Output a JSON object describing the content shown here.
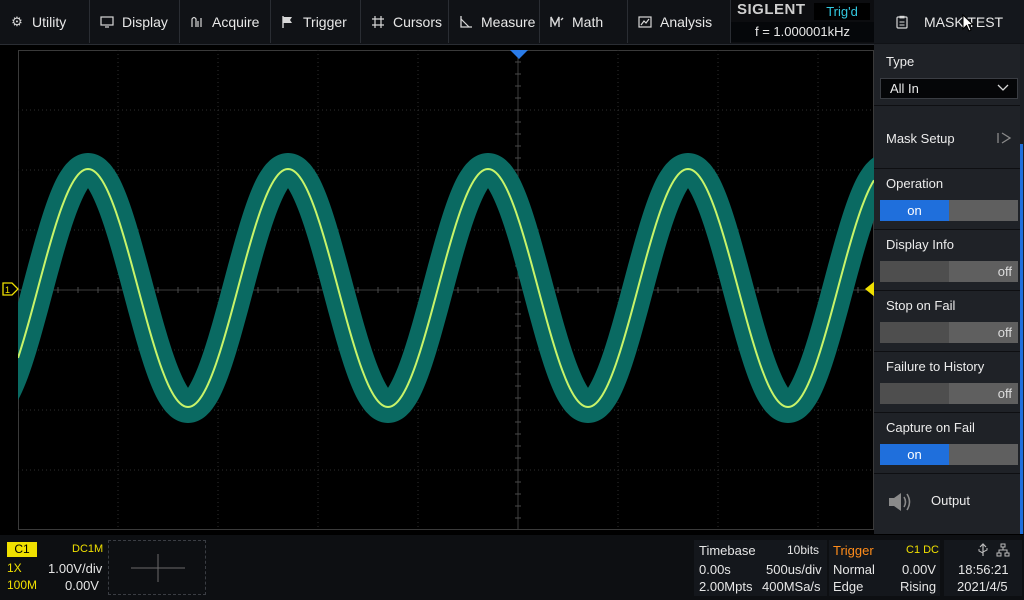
{
  "menu": {
    "items": [
      {
        "label": "Utility",
        "icon": "gear-icon"
      },
      {
        "label": "Display",
        "icon": "monitor-icon"
      },
      {
        "label": "Acquire",
        "icon": "acquire-icon"
      },
      {
        "label": "Trigger",
        "icon": "flag-icon"
      },
      {
        "label": "Cursors",
        "icon": "cursor-icon"
      },
      {
        "label": "Measure",
        "icon": "ruler-icon"
      },
      {
        "label": "Math",
        "icon": "math-icon"
      },
      {
        "label": "Analysis",
        "icon": "analysis-icon"
      }
    ]
  },
  "brand": {
    "logo": "SIGLENT",
    "trigger_status": "Trig'd",
    "frequency": "f = 1.000001kHz"
  },
  "panel": {
    "title": "MASK TEST",
    "title_icon": "clipboard-icon",
    "type_label": "Type",
    "type_value": "All In",
    "mask_setup": "Mask Setup",
    "operation_label": "Operation",
    "operation_state": "on",
    "display_info_label": "Display Info",
    "display_info_state": "off",
    "stop_on_fail_label": "Stop on Fail",
    "stop_on_fail_state": "off",
    "failure_history_label": "Failure to History",
    "failure_history_state": "off",
    "capture_on_fail_label": "Capture on Fail",
    "capture_on_fail_state": "on",
    "output_label": "Output",
    "output_icon": "speaker-icon"
  },
  "channel": {
    "name": "C1",
    "coupling": "DC1M",
    "probe": "1X",
    "scale": "1.00V/div",
    "bandwidth": "100M",
    "offset": "0.00V"
  },
  "timebase": {
    "label": "Timebase",
    "bits": "10bits",
    "delay": "0.00s",
    "scale": "500us/div",
    "memory": "2.00Mpts",
    "sample_rate": "400MSa/s"
  },
  "trigger": {
    "label": "Trigger",
    "source": "C1 DC",
    "mode": "Normal",
    "level": "0.00V",
    "type": "Edge",
    "slope": "Rising"
  },
  "status": {
    "time": "18:56:21",
    "date": "2021/4/5"
  },
  "colors": {
    "trace": "#c8f46a",
    "mask": "#0a6a62",
    "channel": "#f0e000",
    "accent": "#1f6fdc",
    "trigger_label": "#ff8c1a"
  }
}
